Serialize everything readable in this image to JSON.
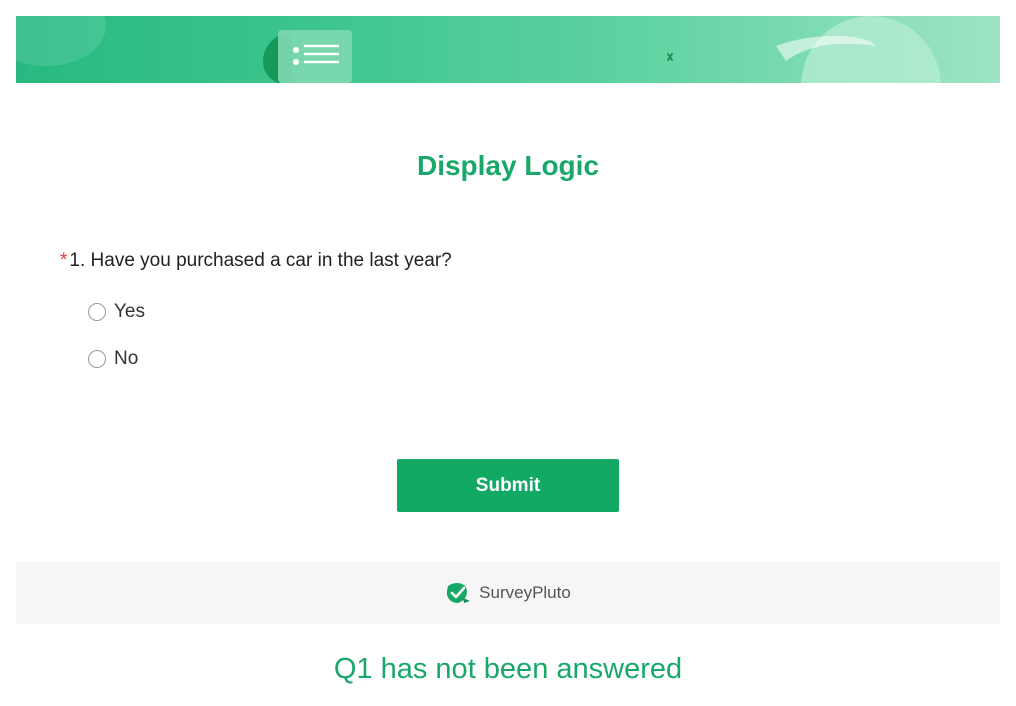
{
  "survey": {
    "title": "Display Logic",
    "question": {
      "required_mark": "*",
      "text": "1. Have you purchased a car in the last year?",
      "options": [
        "Yes",
        "No"
      ]
    },
    "submit_label": "Submit"
  },
  "footer": {
    "brand": "SurveyPluto"
  },
  "status": {
    "message": "Q1 has not been answered"
  },
  "colors": {
    "accent": "#1aa86a",
    "button": "#12a965",
    "required": "#e53935"
  }
}
